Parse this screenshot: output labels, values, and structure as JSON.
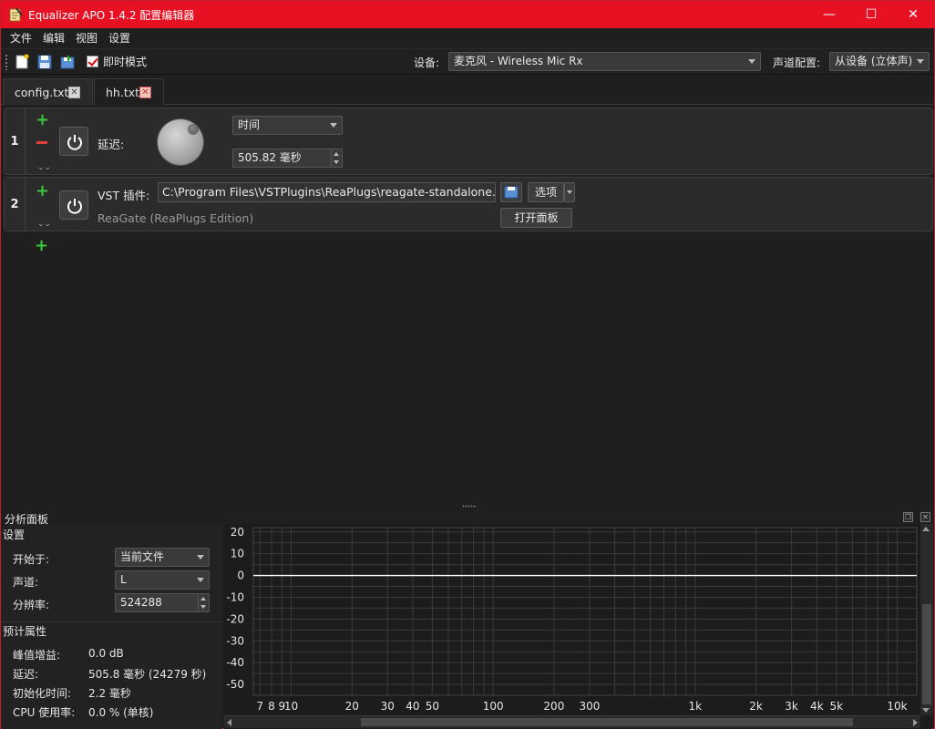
{
  "window": {
    "title": "Equalizer APO 1.4.2 配置编辑器",
    "minimize": "—",
    "maximize": "☐",
    "close": "✕"
  },
  "menu": {
    "items": [
      "文件",
      "编辑",
      "视图",
      "设置"
    ]
  },
  "toolbar": {
    "instant_mode_label": "即时模式",
    "instant_mode_checked": true,
    "device_label": "设备:",
    "device_value": "麦克风 - Wireless Mic Rx",
    "channel_config_label": "声道配置:",
    "channel_config_value": "从设备 (立体声)"
  },
  "tabs": [
    {
      "label": "config.txt",
      "active": false,
      "close": "✕"
    },
    {
      "label": "hh.txt",
      "active": true,
      "close": "✕"
    }
  ],
  "filters": [
    {
      "number": "1",
      "type_label": "延迟:",
      "mode_value": "时间",
      "delay_value": "505.82 毫秒"
    },
    {
      "number": "2",
      "type_label": "VST 插件:",
      "path_value": "C:\\Program Files\\VSTPlugins\\ReaPlugs\\reagate-standalone.dll",
      "options_label": "选项",
      "open_panel_label": "打开面板",
      "plugin_name": "ReaGate (ReaPlugs Edition)"
    }
  ],
  "analysis": {
    "panel_title": "分析面板",
    "settings_title": "设置",
    "start_at_label": "开始于:",
    "start_at_value": "当前文件",
    "channel_label": "声道:",
    "channel_value": "L",
    "resolution_label": "分辨率:",
    "resolution_value": "524288",
    "estimated_title": "预计属性",
    "peak_gain_label": "峰值增益:",
    "peak_gain_value": "0.0 dB",
    "latency_label": "延迟:",
    "latency_value": "505.8 毫秒 (24279 秒)",
    "init_time_label": "初始化时间:",
    "init_time_value": "2.2 毫秒",
    "cpu_label": "CPU 使用率:",
    "cpu_value": "0.0 % (单核)"
  },
  "chart_data": {
    "type": "line",
    "title": "",
    "xlabel": "",
    "ylabel": "",
    "x_scale": "log",
    "xlim": [
      6.5,
      12500
    ],
    "ylim": [
      -55,
      22
    ],
    "x_tick_labels": [
      "7",
      "8",
      "9",
      "10",
      "20",
      "30",
      "40",
      "50",
      "100",
      "200",
      "300",
      "1k",
      "2k",
      "3k",
      "4k",
      "5k",
      "10k"
    ],
    "x_tick_values": [
      7,
      8,
      9,
      10,
      20,
      30,
      40,
      50,
      100,
      200,
      300,
      1000,
      2000,
      3000,
      4000,
      5000,
      10000
    ],
    "y_tick_labels": [
      "20",
      "10",
      "0",
      "-10",
      "-20",
      "-30",
      "-40",
      "-50"
    ],
    "y_tick_values": [
      20,
      10,
      0,
      -10,
      -20,
      -30,
      -40,
      -50
    ],
    "grid": true,
    "series": [
      {
        "x": [
          6.5,
          12500
        ],
        "y": [
          0,
          0
        ]
      }
    ],
    "colors": {
      "line": "#ffffff",
      "grid": "#3a3a3a",
      "background": "#1c1c1c"
    }
  },
  "colors": {
    "title_bar": "#e81123",
    "add": "#3cc83c",
    "remove": "#e0403a"
  }
}
